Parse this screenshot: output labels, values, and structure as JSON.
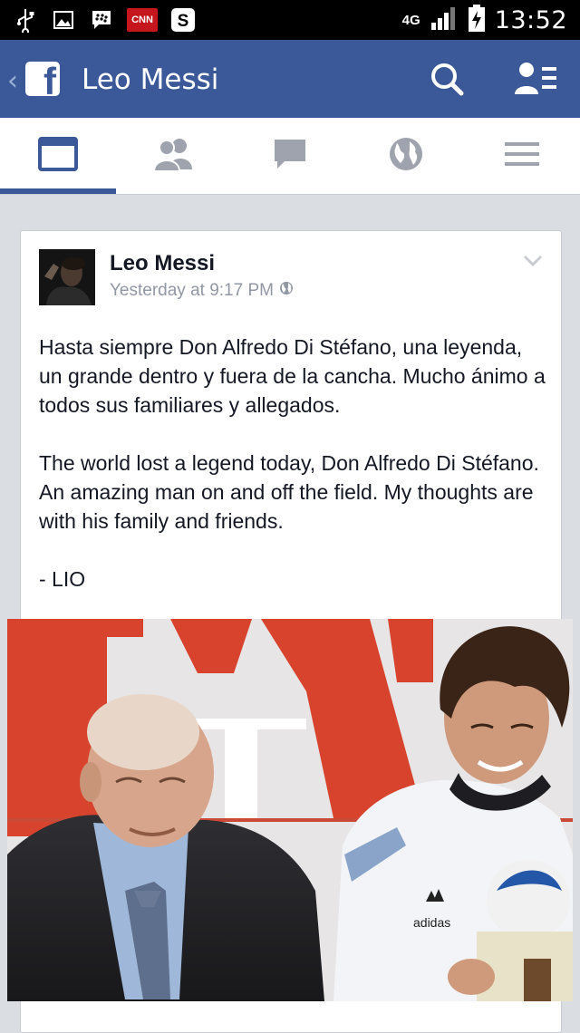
{
  "status_bar": {
    "cnn_badge": "CNN",
    "network": "4G",
    "time": "13:52"
  },
  "header": {
    "page_title": "Leo Messi",
    "accent": "#3b5998"
  },
  "nav": {
    "tabs": [
      "news-feed",
      "friend-requests",
      "messages",
      "notifications",
      "more"
    ],
    "active_tab": 0
  },
  "post": {
    "author": "Leo Messi",
    "timestamp": "Yesterday at 9:17 PM",
    "paragraphs": [
      "Hasta siempre Don Alfredo Di Stéfano, una leyenda, un grande dentro y fuera de la cancha. Mucho ánimo a todos sus familiares y allegados.",
      "The world lost a legend today, Don Alfredo Di Stéfano. An amazing man on and off the field. My thoughts are with his family and friends.",
      "- LIO"
    ],
    "photo": {
      "shirt_brand": "adidas"
    }
  }
}
